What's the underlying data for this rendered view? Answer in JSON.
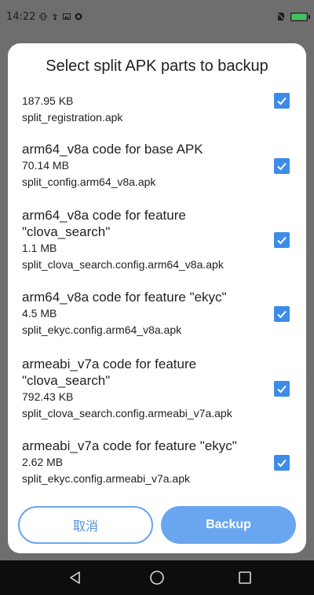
{
  "status_bar": {
    "time": "14:22",
    "battery_level_percent": 100,
    "battery_color": "#3ac65a"
  },
  "dialog": {
    "title": "Select split APK parts to backup",
    "items": [
      {
        "title": "",
        "size": "187.95 KB",
        "file": "split_registration.apk",
        "checked": true
      },
      {
        "title": "arm64_v8a code for base APK",
        "size": "70.14 MB",
        "file": "split_config.arm64_v8a.apk",
        "checked": true
      },
      {
        "title_line1": "arm64_v8a code for feature",
        "title_line2": "\"clova_search\"",
        "size": "1.1 MB",
        "file": "split_clova_search.config.arm64_v8a.apk",
        "checked": true
      },
      {
        "title": "arm64_v8a code for feature \"ekyc\"",
        "size": "4.5 MB",
        "file": "split_ekyc.config.arm64_v8a.apk",
        "checked": true
      },
      {
        "title_line1": "armeabi_v7a code for feature",
        "title_line2": "\"clova_search\"",
        "size": "792.43 KB",
        "file": "split_clova_search.config.armeabi_v7a.apk",
        "checked": true
      },
      {
        "title": "armeabi_v7a code for feature \"ekyc\"",
        "size": "2.62 MB",
        "file": "split_ekyc.config.armeabi_v7a.apk",
        "checked": true
      }
    ],
    "cancel_label": "取消",
    "backup_label": "Backup"
  },
  "colors": {
    "accent": "#3d8ce8",
    "button_light": "#6aa6f0",
    "overlay": "#6e6e6e",
    "nav_bar": "#0d0d0d"
  },
  "icons": {
    "checkbox": "checkbox-checked-icon",
    "nav_back": "triangle-back-icon",
    "nav_home": "circle-home-icon",
    "nav_recents": "square-recents-icon"
  }
}
